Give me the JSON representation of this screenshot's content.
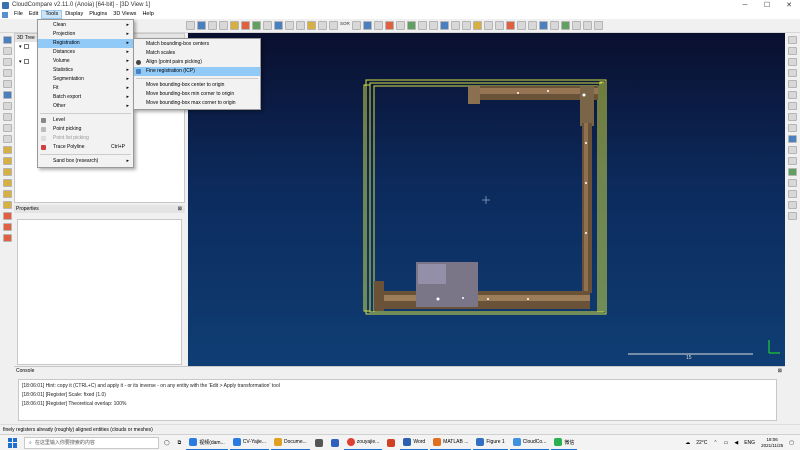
{
  "window": {
    "title": "CloudCompare v2.11.0 (Anoia) [64-bit] - [3D View 1]",
    "minimize": "─",
    "maximize": "☐",
    "close": "✕"
  },
  "menubar": {
    "items": [
      "File",
      "Edit",
      "Tools",
      "Display",
      "Plugins",
      "3D Views",
      "Help"
    ]
  },
  "toolbar": {
    "sor_label": "SOR"
  },
  "dbtree": {
    "title": "3D Tree"
  },
  "properties": {
    "title": "Properties",
    "close": "⊠"
  },
  "tools_menu": {
    "items": [
      {
        "label": "Clean",
        "submenu": true
      },
      {
        "label": "Projection",
        "submenu": true
      },
      {
        "label": "Registration",
        "submenu": true
      },
      {
        "label": "Distances",
        "submenu": true
      },
      {
        "label": "Volume",
        "submenu": true
      },
      {
        "label": "Statistics",
        "submenu": true
      },
      {
        "label": "Segmentation",
        "submenu": true
      },
      {
        "label": "Fit",
        "submenu": true
      },
      {
        "label": "Batch export",
        "submenu": true
      },
      {
        "label": "Other",
        "submenu": true
      },
      {
        "label": "Level"
      },
      {
        "label": "Point picking"
      },
      {
        "label": "Point list picking"
      },
      {
        "label": "Trace Polyline",
        "shortcut": "Ctrl+P"
      },
      {
        "label": "Sand box (research)",
        "submenu": true
      }
    ]
  },
  "registration_menu": {
    "items": [
      "Match bounding-box centers",
      "Match scales",
      "Align (point pairs picking)",
      "Fine registration (ICP)",
      "Move bounding-box center to origin",
      "Move bounding-box min corner to origin",
      "Move bounding-box max corner to origin"
    ]
  },
  "view3d": {
    "scale_label": "15"
  },
  "console": {
    "title": "Console",
    "close": "⊠",
    "lines": [
      "[18:06:01] Hint: copy it (CTRL+C) and apply it - or its inverse - on any entity with the 'Edit > Apply transformation' tool",
      "[18:06:01] [Register] Scale: fixed (1.0)",
      "[18:06:01] [Register] Theoretical overlap: 100%"
    ]
  },
  "statusbar": {
    "text": "finely registers already (roughly) aligned entities (clouds or meshes)"
  },
  "taskbar": {
    "search_placeholder": "在这里输入你要搜索的内容",
    "items": [
      {
        "label": "视频(dam...",
        "color": "#2a7ae0"
      },
      {
        "label": "CV-Yajie...",
        "color": "#2a7ae0"
      },
      {
        "label": "Docume...",
        "color": "#e0a020"
      },
      {
        "label": "",
        "color": "#555"
      },
      {
        "label": "",
        "color": "#3060c0"
      },
      {
        "label": "zouyajie...",
        "color": "#e04030"
      },
      {
        "label": "",
        "color": "#d04020"
      },
      {
        "label": "Word",
        "color": "#2b5fb0"
      },
      {
        "label": "MATLAB ...",
        "color": "#e07020"
      },
      {
        "label": "Figure 1",
        "color": "#3070c0"
      },
      {
        "label": "CloudCo...",
        "color": "#4090e0"
      },
      {
        "label": "微信",
        "color": "#2ab050"
      }
    ],
    "weather": "22°C",
    "lang": "ENG",
    "time": "18:06",
    "date": "2021/11/25"
  },
  "colors": {
    "menu_highlight": "#91c9f7",
    "bbox": "#d4e040",
    "view_bg_top": "#0a0f2e",
    "view_bg_bottom": "#0f3e74",
    "axis_green": "#22cc33"
  }
}
